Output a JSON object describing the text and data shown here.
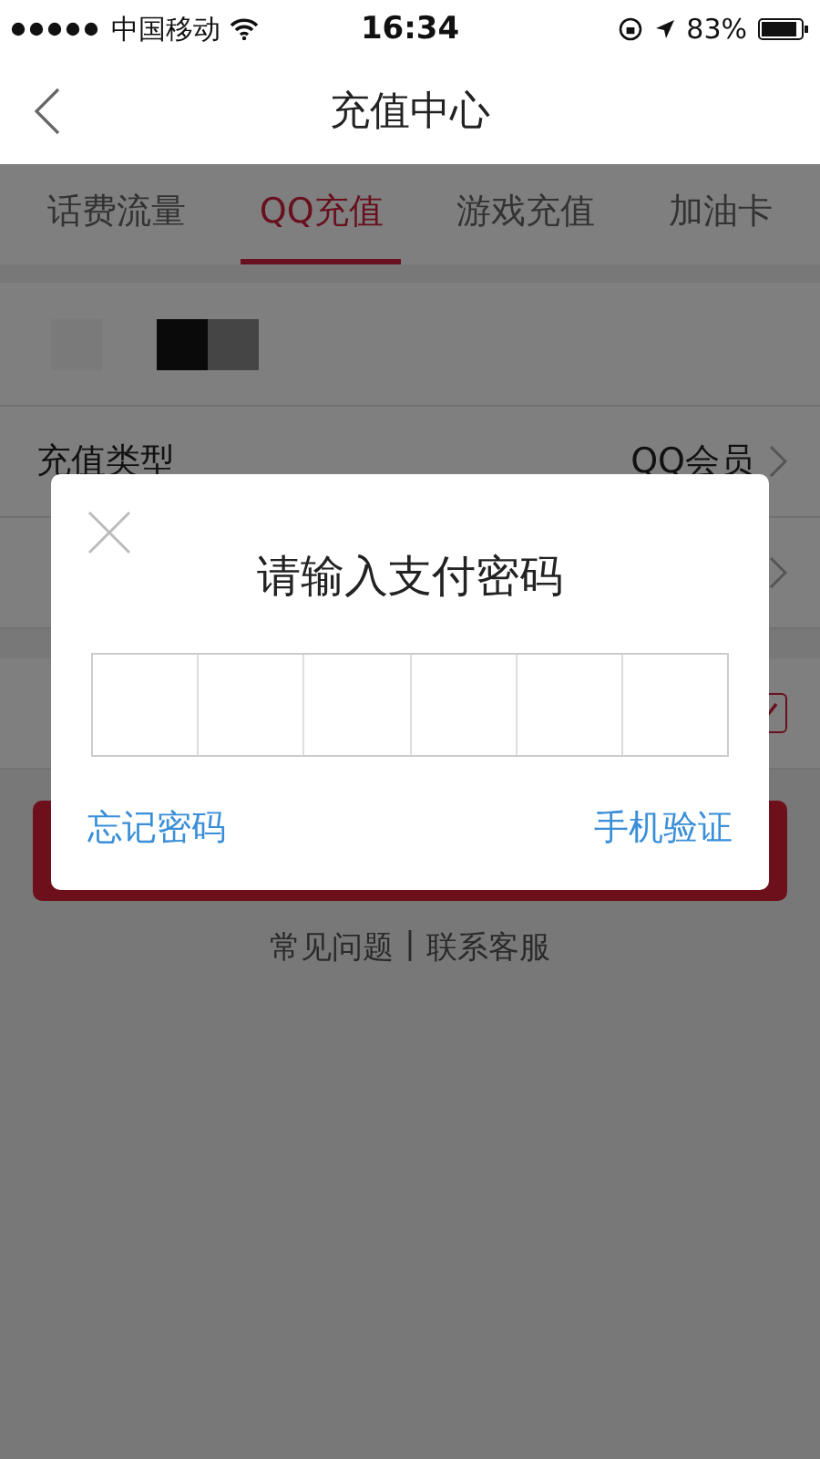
{
  "status_bar": {
    "carrier": "中国移动",
    "time": "16:34",
    "battery": "83%"
  },
  "nav": {
    "title": "充值中心"
  },
  "tabs": [
    {
      "label": "话费流量",
      "selected": false
    },
    {
      "label": "QQ充值",
      "selected": true
    },
    {
      "label": "游戏充值",
      "selected": false
    },
    {
      "label": "加油卡",
      "selected": false
    }
  ],
  "form": {
    "rows": [
      {
        "kind": "select",
        "label": "充值类型",
        "value": "QQ会员"
      },
      {
        "kind": "select"
      },
      {
        "kind": "check",
        "checked": true
      }
    ],
    "help_links": [
      "常见问题",
      "联系客服"
    ],
    "separator": "|"
  },
  "dialog": {
    "title": "请输入支付密码",
    "password_cells": [
      {
        "filled": false
      },
      {
        "filled": false
      },
      {
        "filled": false
      },
      {
        "filled": false
      },
      {
        "filled": false
      },
      {
        "filled": false
      }
    ],
    "links": [
      "忘记密码",
      "手机验证"
    ]
  }
}
